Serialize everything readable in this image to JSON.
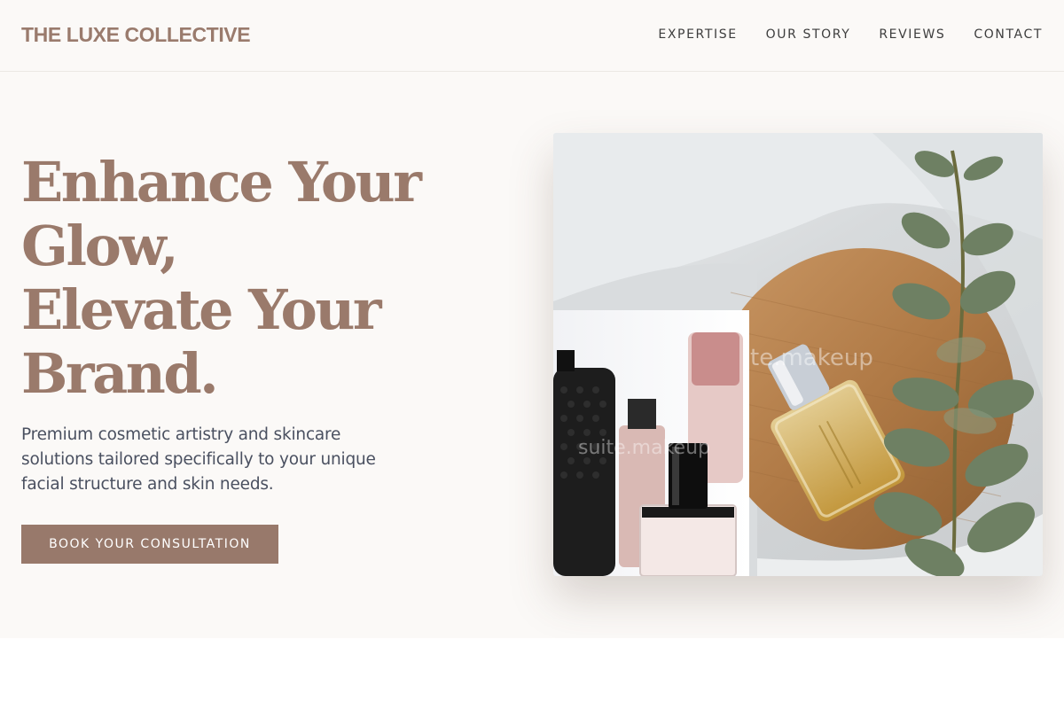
{
  "brand": {
    "name": "THE LUXE COLLECTIVE",
    "color": "#9a7b6d"
  },
  "nav": {
    "items": [
      {
        "label": "EXPERTISE"
      },
      {
        "label": "OUR STORY"
      },
      {
        "label": "REVIEWS"
      },
      {
        "label": "CONTACT"
      }
    ]
  },
  "hero": {
    "headline_lines": [
      "Enhance Your",
      "Glow,",
      "Elevate Your",
      "Brand."
    ],
    "subtitle": "Premium cosmetic artistry and skincare solutions tailored specifically to your unique facial structure and skin needs.",
    "cta_label": "BOOK YOUR CONSULTATION",
    "accent_color": "#98796b"
  },
  "image": {
    "description_icon": "cosmetics-photo-icon",
    "watermarks": [
      "te.makeup",
      "suite.makeup"
    ]
  }
}
